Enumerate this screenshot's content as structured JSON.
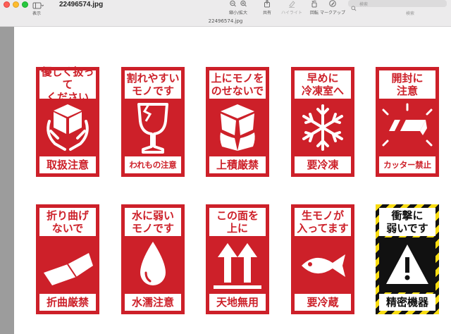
{
  "window": {
    "title": "22496574.jpg",
    "subtitle": "22496574.jpg"
  },
  "toolbar": {
    "view_label": "表示",
    "zoom_label": "縮小/拡大",
    "share_label": "共有",
    "highlight_label": "ハイライト",
    "rotate_label": "回転",
    "markup_label": "マークアップ",
    "search_placeholder": "検索",
    "search_label": "検索"
  },
  "labels": [
    {
      "top": "優しく扱って\nください",
      "bottom": "取扱注意",
      "icon": "hands-box-icon"
    },
    {
      "top": "割れやすい\nモノです",
      "bottom": "われもの注意",
      "icon": "broken-glass-icon"
    },
    {
      "top": "上にモノを\nのせないで",
      "bottom": "上積厳禁",
      "icon": "crushed-box-icon"
    },
    {
      "top": "早めに\n冷凍室へ",
      "bottom": "要冷凍",
      "icon": "snowflake-icon"
    },
    {
      "top": "開封に\n注意",
      "bottom": "カッター禁止",
      "icon": "cutter-icon"
    },
    {
      "top": "折り曲げ\nないで",
      "bottom": "折曲厳禁",
      "icon": "folded-sheet-icon"
    },
    {
      "top": "水に弱い\nモノです",
      "bottom": "水濡注意",
      "icon": "water-drop-icon"
    },
    {
      "top": "この面を\n上に",
      "bottom": "天地無用",
      "icon": "up-arrows-icon"
    },
    {
      "top": "生モノが\n入ってます",
      "bottom": "要冷蔵",
      "icon": "fish-icon"
    },
    {
      "top": "衝撃に\n弱いです",
      "bottom": "精密機器",
      "icon": "warning-triangle-icon"
    }
  ],
  "colors": {
    "label_red": "#cd2029",
    "hazard_yellow": "#f8dc12",
    "hazard_black": "#111111"
  }
}
